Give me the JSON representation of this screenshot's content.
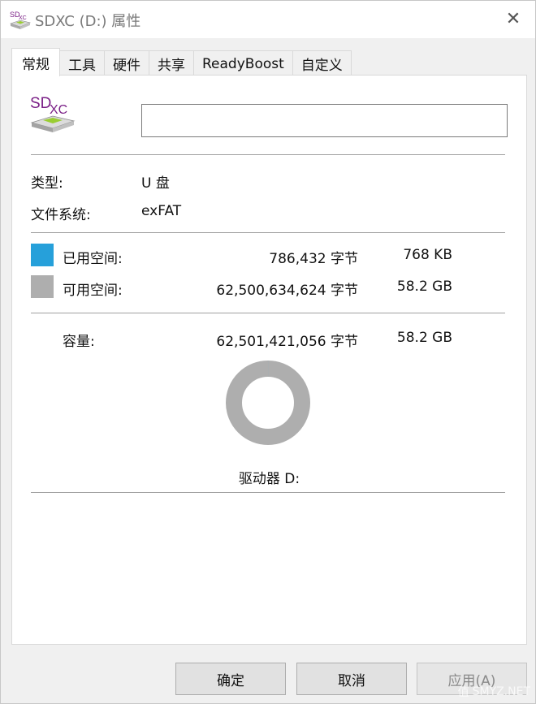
{
  "window": {
    "title": "SDXC (D:) 属性",
    "close_glyph": "✕"
  },
  "tabs": [
    {
      "label": "常规",
      "active": true
    },
    {
      "label": "工具"
    },
    {
      "label": "硬件"
    },
    {
      "label": "共享"
    },
    {
      "label": "ReadyBoost"
    },
    {
      "label": "自定义"
    }
  ],
  "general": {
    "icon": "sdxc-drive-icon",
    "icon_text_sd": "SD",
    "icon_text_xc": "XC",
    "volume_name": "",
    "type_label": "类型:",
    "type_value": "U 盘",
    "fs_label": "文件系统:",
    "fs_value": "exFAT",
    "used": {
      "label": "已用空间:",
      "bytes": "786,432 字节",
      "size": "768 KB",
      "color": "#26a0da"
    },
    "free": {
      "label": "可用空间:",
      "bytes": "62,500,634,624 字节",
      "size": "58.2 GB",
      "color": "#aeaeae"
    },
    "capacity": {
      "label": "容量:",
      "bytes": "62,501,421,056 字节",
      "size": "58.2 GB"
    },
    "used_fraction": 1.26e-05,
    "drive_label": "驱动器 D:"
  },
  "buttons": {
    "ok": "确定",
    "cancel": "取消",
    "apply": "应用(A)"
  },
  "watermark": {
    "text": "SMYZ.NET",
    "glyph": "值"
  }
}
